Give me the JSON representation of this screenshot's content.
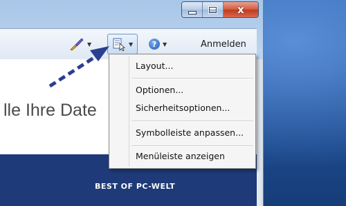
{
  "window": {
    "close_label": "x"
  },
  "toolbar": {
    "brush_icon": "brush-icon",
    "page_icon": "page-icon",
    "help_icon": "help-icon",
    "help_glyph": "?",
    "login_label": "Anmelden"
  },
  "content": {
    "headline": "lle Ihre Date",
    "band_text": "BEST OF PC-WELT"
  },
  "menu": {
    "items": [
      {
        "label": "Layout..."
      },
      {
        "label": "Optionen..."
      },
      {
        "label": "Sicherheitsoptionen..."
      },
      {
        "label": "Symbolleiste anpassen..."
      },
      {
        "label": "Menüleiste anzeigen"
      }
    ]
  },
  "colors": {
    "desktop": "#2f64b4",
    "band": "#1e3a78",
    "arrow": "#2a3f8f"
  }
}
